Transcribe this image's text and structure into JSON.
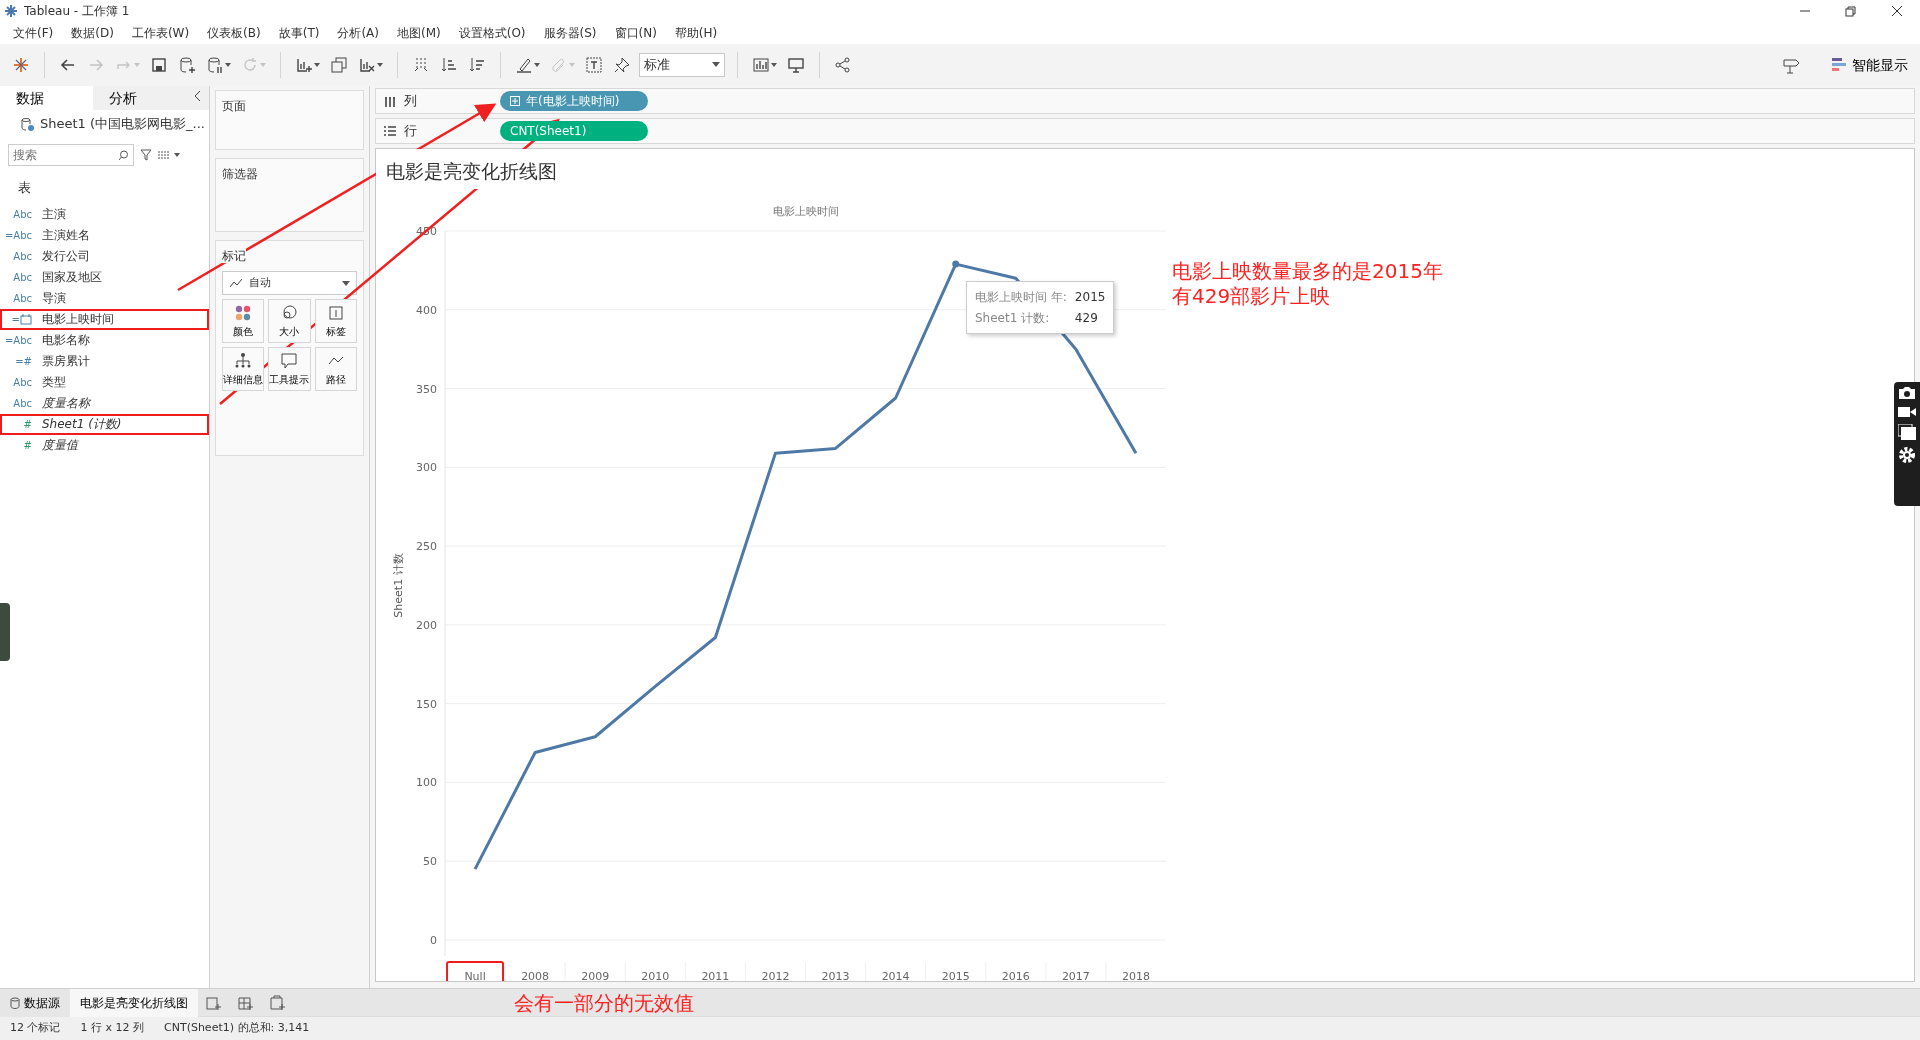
{
  "window": {
    "title": "Tableau - 工作簿 1"
  },
  "menu": [
    "文件(F)",
    "数据(D)",
    "工作表(W)",
    "仪表板(B)",
    "故事(T)",
    "分析(A)",
    "地图(M)",
    "设置格式(O)",
    "服务器(S)",
    "窗口(N)",
    "帮助(H)"
  ],
  "toolbar": [
    [
      {
        "kind": "logo",
        "disabled": false,
        "dropdown": false
      }
    ],
    [
      {
        "kind": "back",
        "disabled": false,
        "dropdown": false
      },
      {
        "kind": "forward",
        "disabled": true,
        "dropdown": false
      },
      {
        "kind": "redo",
        "disabled": true,
        "dropdown": true
      },
      {
        "kind": "save",
        "disabled": false,
        "dropdown": false
      },
      {
        "kind": "add-db",
        "disabled": false,
        "dropdown": false
      },
      {
        "kind": "pause-db",
        "disabled": false,
        "dropdown": true
      },
      {
        "kind": "refresh",
        "disabled": true,
        "dropdown": true
      }
    ],
    [
      {
        "kind": "new-sheet",
        "disabled": false,
        "dropdown": true
      },
      {
        "kind": "duplicate",
        "disabled": false,
        "dropdown": false
      },
      {
        "kind": "clear",
        "disabled": false,
        "dropdown": true
      }
    ],
    [
      {
        "kind": "swap",
        "disabled": false,
        "dropdown": false
      },
      {
        "kind": "sort-asc",
        "disabled": false,
        "dropdown": false
      },
      {
        "kind": "sort-desc",
        "disabled": false,
        "dropdown": false
      }
    ],
    [
      {
        "kind": "pen",
        "disabled": false,
        "dropdown": true
      },
      {
        "kind": "clip",
        "disabled": true,
        "dropdown": true
      },
      {
        "kind": "text",
        "disabled": false,
        "dropdown": false
      },
      {
        "kind": "pin",
        "disabled": false,
        "dropdown": false
      },
      {
        "kind": "fit",
        "disabled": false,
        "dropdown": true
      }
    ],
    [
      {
        "kind": "chart",
        "disabled": false,
        "dropdown": true
      },
      {
        "kind": "present",
        "disabled": false,
        "dropdown": false
      }
    ],
    [
      {
        "kind": "share",
        "disabled": false,
        "dropdown": false
      }
    ]
  ],
  "fit_select": {
    "value": "标准"
  },
  "show_me": {
    "label": "智能显示"
  },
  "data_pane": {
    "tabs": [
      {
        "label": "数据",
        "selected": true
      },
      {
        "label": "分析",
        "selected": false
      }
    ],
    "source": "Sheet1 (中国电影网电影_...",
    "search": {
      "placeholder": "搜索"
    },
    "section": "表",
    "fields": [
      {
        "kind": "text",
        "icon_label": "Abc",
        "name": "主演",
        "italic": false,
        "measure": false,
        "highlighted": false
      },
      {
        "kind": "text",
        "icon_label": "=Abc",
        "name": "主演姓名",
        "italic": false,
        "measure": false,
        "highlighted": false
      },
      {
        "kind": "text",
        "icon_label": "Abc",
        "name": "发行公司",
        "italic": false,
        "measure": false,
        "highlighted": false
      },
      {
        "kind": "text",
        "icon_label": "Abc",
        "name": "国家及地区",
        "italic": false,
        "measure": false,
        "highlighted": false
      },
      {
        "kind": "text",
        "icon_label": "Abc",
        "name": "导演",
        "italic": false,
        "measure": false,
        "highlighted": false
      },
      {
        "kind": "date",
        "icon_label": "=",
        "name": "电影上映时间",
        "italic": false,
        "measure": false,
        "highlighted": true
      },
      {
        "kind": "text",
        "icon_label": "=Abc",
        "name": "电影名称",
        "italic": false,
        "measure": false,
        "highlighted": false
      },
      {
        "kind": "text",
        "icon_label": "=#",
        "name": "票房累计",
        "italic": false,
        "measure": false,
        "highlighted": false
      },
      {
        "kind": "text",
        "icon_label": "Abc",
        "name": "类型",
        "italic": false,
        "measure": false,
        "highlighted": false
      },
      {
        "kind": "text",
        "icon_label": "Abc",
        "name": "度量名称",
        "italic": true,
        "measure": false,
        "highlighted": false
      },
      {
        "kind": "text",
        "icon_label": "#",
        "name": "Sheet1 (计数)",
        "italic": true,
        "measure": true,
        "highlighted": true
      },
      {
        "kind": "text",
        "icon_label": "#",
        "name": "度量值",
        "italic": true,
        "measure": true,
        "highlighted": false
      }
    ]
  },
  "cards": {
    "pages": "页面",
    "filters": "筛选器",
    "marks": {
      "title": "标记",
      "type": "自动",
      "buttons": [
        {
          "kind": "color",
          "label": "颜色"
        },
        {
          "kind": "size",
          "label": "大小"
        },
        {
          "kind": "label",
          "label": "标签"
        },
        {
          "kind": "detail",
          "label": "详细信息"
        },
        {
          "kind": "tooltip",
          "label": "工具提示"
        },
        {
          "kind": "path",
          "label": "路径"
        }
      ]
    }
  },
  "shelves": [
    {
      "kind": "columns",
      "label": "列",
      "pill": {
        "text": "年(电影上映时间)",
        "kind": "dimension",
        "expandable": true
      }
    },
    {
      "kind": "rows",
      "label": "行",
      "pill": {
        "text": "CNT(Sheet1)",
        "kind": "measure",
        "expandable": false
      }
    }
  ],
  "sheet": {
    "title": "电影是亮变化折线图",
    "chart_data": {
      "type": "line",
      "xlabel": "电影上映时间",
      "ylabel": "Sheet1 计数",
      "categories": [
        "Null",
        "2008",
        "2009",
        "2010",
        "2011",
        "2012",
        "2013",
        "2014",
        "2015",
        "2016",
        "2017",
        "2018"
      ],
      "series": [
        {
          "color": "#4e79a7",
          "values": [
            45,
            119,
            129,
            161,
            192,
            309,
            312,
            344,
            429,
            420,
            375,
            309
          ]
        }
      ],
      "grid": true,
      "ylim": [
        0,
        450
      ],
      "yticks": [
        0,
        50,
        100,
        150,
        200,
        250,
        300,
        350,
        400,
        450
      ]
    },
    "tooltip": {
      "rows": [
        {
          "label": "电影上映时间 年:",
          "value": "2015"
        },
        {
          "label": "Sheet1 计数:",
          "value": "429"
        }
      ]
    }
  },
  "annotations": {
    "notes": [
      {
        "kind": "chart",
        "lines": [
          "电影上映数量最多的是2015年",
          "有429部影片上映"
        ]
      },
      {
        "kind": "footer",
        "lines": [
          "会有一部分的无效值"
        ]
      }
    ],
    "first_tick_boxed": true
  },
  "sheet_tabs": [
    {
      "kind": "datasource",
      "label": "数据源",
      "selected": false
    },
    {
      "kind": "sheet",
      "label": "电影是亮变化折线图",
      "selected": true
    }
  ],
  "status_bar": [
    "12 个标记",
    "1 行 x 12 列",
    "CNT(Sheet1) 的总和: 3,141"
  ]
}
